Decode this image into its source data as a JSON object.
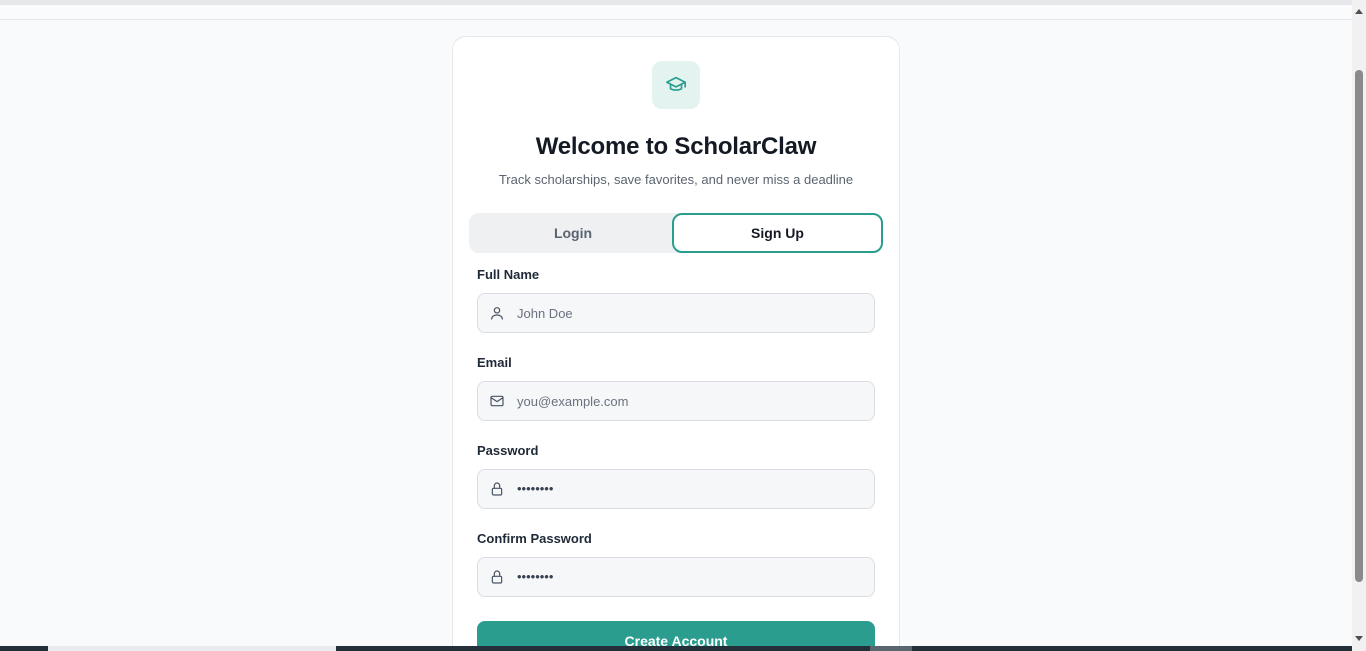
{
  "app": {
    "title": "Welcome to ScholarClaw",
    "subtitle": "Track scholarships, save favorites, and never miss a deadline",
    "logo_icon": "graduation-cap-icon",
    "accent_color": "#2a9d8f"
  },
  "tabs": [
    {
      "label": "Login",
      "active": false
    },
    {
      "label": "Sign Up",
      "active": true
    }
  ],
  "form": {
    "full_name": {
      "label": "Full Name",
      "placeholder": "John Doe",
      "icon": "user-icon"
    },
    "email": {
      "label": "Email",
      "placeholder": "you@example.com",
      "icon": "mail-icon"
    },
    "password": {
      "label": "Password",
      "masked_value": "••••••••",
      "icon": "lock-icon"
    },
    "confirm_password": {
      "label": "Confirm Password",
      "masked_value": "••••••••",
      "icon": "lock-icon"
    },
    "submit_label": "Create Account"
  }
}
